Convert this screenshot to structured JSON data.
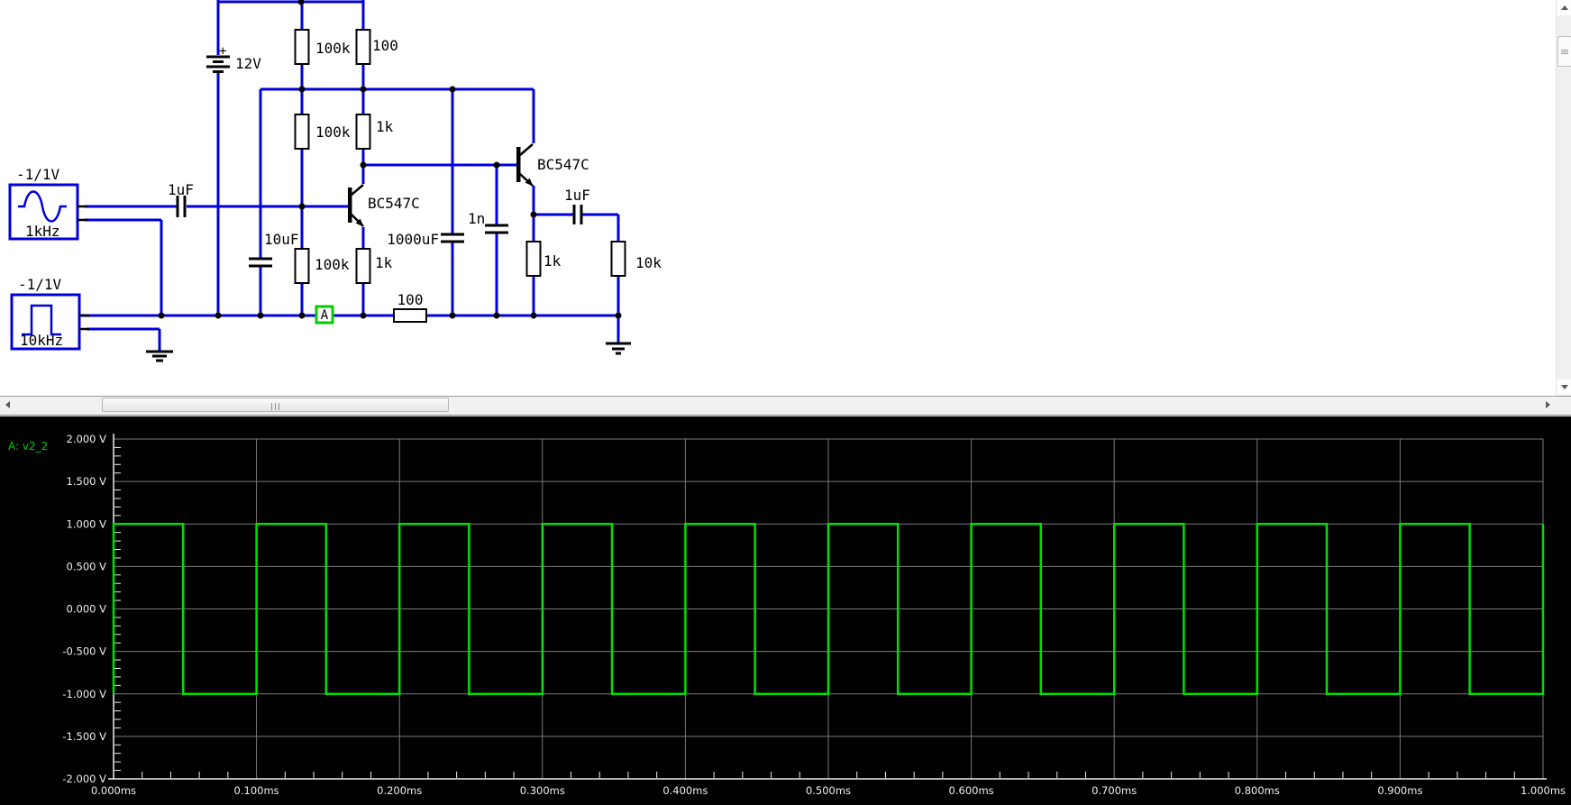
{
  "app": {
    "accent_wire_color": "#0000dd",
    "probe_color": "#00cc00"
  },
  "schematic": {
    "battery": {
      "label": "12V",
      "plus": "+"
    },
    "source_sine": {
      "range": "-1/1V",
      "freq": "1kHz"
    },
    "source_square": {
      "range": "-1/1V",
      "freq": "10kHz"
    },
    "resistors": {
      "r_top1": "100k",
      "r_top2": "100",
      "r_mid1": "100k",
      "r_mid2": "1k",
      "r_bot1": "100k",
      "r_bot2": "1k",
      "r_series": "100",
      "r_q2_emitter": "1k",
      "r_out": "10k"
    },
    "capacitors": {
      "c_in": "1uF",
      "c_bypass": "10uF",
      "c_supply": "1000uF",
      "c_small": "1n",
      "c_out": "1uF"
    },
    "transistors": {
      "q1": "BC547C",
      "q2": "BC547C"
    },
    "probe_label": "A"
  },
  "plot": {
    "trace_label": "A: v2_2",
    "trace_color": "#00e000",
    "grid_color": "#7b7b7b",
    "axis_color": "#f0f0f0",
    "chart_data": {
      "type": "line",
      "title": "",
      "xlabel_unit": "ms",
      "ylabel_unit": "V",
      "xlim_ms": [
        0.0,
        1.0
      ],
      "ylim_v": [
        -2.0,
        2.0
      ],
      "grid": true,
      "y_ticks": [
        {
          "v": 2.0,
          "label": "2.000 V"
        },
        {
          "v": 1.5,
          "label": "1.500 V"
        },
        {
          "v": 1.0,
          "label": "1.000 V"
        },
        {
          "v": 0.5,
          "label": "0.500 V"
        },
        {
          "v": 0.0,
          "label": "0.000 V"
        },
        {
          "v": -0.5,
          "label": "-0.500 V"
        },
        {
          "v": -1.0,
          "label": "-1.000 V"
        },
        {
          "v": -1.5,
          "label": "-1.500 V"
        },
        {
          "v": -2.0,
          "label": "-2.000 V"
        }
      ],
      "x_ticks": [
        {
          "t": 0.0,
          "label": "0.000ms"
        },
        {
          "t": 0.1,
          "label": "0.100ms"
        },
        {
          "t": 0.2,
          "label": "0.200ms"
        },
        {
          "t": 0.3,
          "label": "0.300ms"
        },
        {
          "t": 0.4,
          "label": "0.400ms"
        },
        {
          "t": 0.5,
          "label": "0.500ms"
        },
        {
          "t": 0.6,
          "label": "0.600ms"
        },
        {
          "t": 0.7,
          "label": "0.700ms"
        },
        {
          "t": 0.8,
          "label": "0.800ms"
        },
        {
          "t": 0.9,
          "label": "0.900ms"
        },
        {
          "t": 1.0,
          "label": "1.000ms"
        }
      ],
      "y_minor_step_v": 0.1,
      "x_minor_step_ms": 0.02,
      "waveform": {
        "shape": "square",
        "trace": "A: v2_2",
        "frequency_hz": 10000,
        "period_ms": 0.1,
        "high_v": 1.0,
        "low_v": -1.0,
        "duty_high_fraction": 0.487,
        "t_start_ms": 0.0,
        "t_end_ms": 1.0
      }
    }
  }
}
